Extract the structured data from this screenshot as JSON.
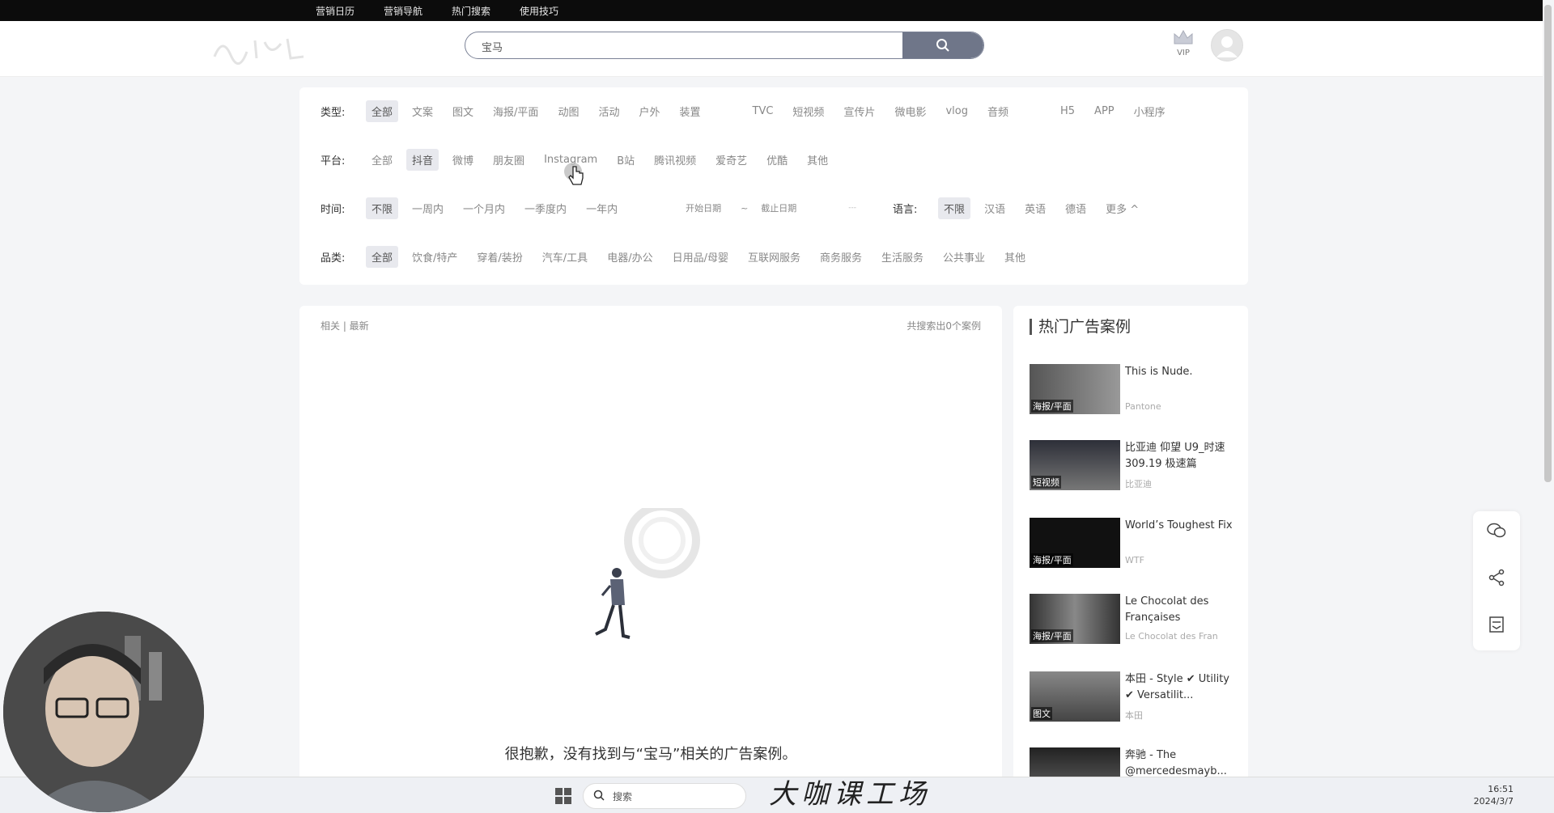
{
  "topnav": [
    "营销日历",
    "营销导航",
    "热门搜索",
    "使用技巧"
  ],
  "search": {
    "value": "宝马"
  },
  "vip_label": "VIP",
  "filters": {
    "type": {
      "label": "类型:",
      "options": [
        "全部",
        "文案",
        "图文",
        "海报/平面",
        "动图",
        "活动",
        "户外",
        "装置",
        "TVC",
        "短视频",
        "宣传片",
        "微电影",
        "vlog",
        "音频",
        "H5",
        "APP",
        "小程序"
      ],
      "selected": "全部"
    },
    "platform": {
      "label": "平台:",
      "options": [
        "全部",
        "抖音",
        "微博",
        "朋友圈",
        "Instagram",
        "B站",
        "腾讯视频",
        "爱奇艺",
        "优酷",
        "其他"
      ],
      "selected": "抖音"
    },
    "time": {
      "label": "时间:",
      "options": [
        "不限",
        "一周内",
        "一个月内",
        "一季度内",
        "一年内"
      ],
      "selected": "不限",
      "start_date": "开始日期",
      "tilde": "~",
      "end_date": "截止日期",
      "dash": "---"
    },
    "language": {
      "label": "语言:",
      "options": [
        "不限",
        "汉语",
        "英语",
        "德语"
      ],
      "selected": "不限",
      "more": "更多 ^"
    },
    "category": {
      "label": "品类:",
      "options": [
        "全部",
        "饮食/特产",
        "穿着/装扮",
        "汽车/工具",
        "电器/办公",
        "日用品/母婴",
        "互联网服务",
        "商务服务",
        "生活服务",
        "公共事业",
        "其他"
      ],
      "selected": "全部"
    }
  },
  "results": {
    "sort": "相关 | 最新",
    "count": "共搜索出0个案例",
    "empty_message": "很抱歉，没有找到与“宝马”相关的广告案例。"
  },
  "hot": {
    "title": "热门广告案例",
    "items": [
      {
        "tag": "海报/平面",
        "title": "This is Nude.",
        "brand": "Pantone"
      },
      {
        "tag": "短视频",
        "title": "比亚迪 仰望 U9_时速309.19 极速篇",
        "brand": "比亚迪"
      },
      {
        "tag": "海报/平面",
        "title": "World’s Toughest Fix",
        "brand": "WTF"
      },
      {
        "tag": "海报/平面",
        "title": "Le Chocolat des Françaises",
        "brand": "Le Chocolat des Fran"
      },
      {
        "tag": "图文",
        "title": "本田 - Style ✔ Utility ✔ Versatilit...",
        "brand": "本田"
      },
      {
        "tag": "",
        "title": "奔驰 - The @mercedesmayb...",
        "brand": ""
      }
    ]
  },
  "taskbar": {
    "search": "搜索",
    "time": "16:51",
    "date": "2024/3/7"
  },
  "watermark": "大咖课工场",
  "colors": {
    "topbar": "#0c0c0c",
    "search_button": "#6f7689",
    "selected_chip": "#e8e9ee"
  }
}
